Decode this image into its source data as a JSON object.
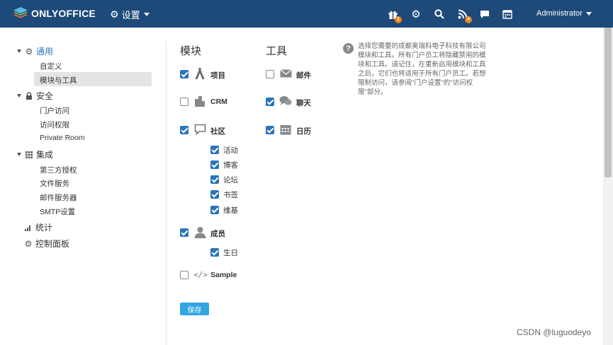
{
  "header": {
    "logo_text": "ONLYOFFICE",
    "settings_label": "设置",
    "badges": {
      "gift": "1",
      "feed": "4"
    },
    "user_name": "Administrator",
    "bg_color": "#1d4a79"
  },
  "sidebar": {
    "general": "通用",
    "general_items": [
      "自定义",
      "模块与工具"
    ],
    "security": "安全",
    "security_items": [
      "门户访问",
      "访问权限",
      "Private Room"
    ],
    "integration": "集成",
    "integration_items": [
      "第三方授权",
      "文件服务",
      "邮件服务器",
      "SMTP设置"
    ],
    "stats": "统计",
    "control_panel": "控制面板"
  },
  "modules": {
    "heading": "模块",
    "items": [
      {
        "label": "项目",
        "checked": true
      },
      {
        "label": "CRM",
        "checked": false
      },
      {
        "label": "社区",
        "checked": true
      },
      {
        "label": "成员",
        "checked": true
      },
      {
        "label": "Sample",
        "checked": false
      }
    ],
    "community_sub": [
      "活动",
      "博客",
      "论坛",
      "书签",
      "维基"
    ],
    "people_sub": [
      "生日"
    ]
  },
  "tools": {
    "heading": "工具",
    "items": [
      {
        "label": "邮件",
        "checked": false
      },
      {
        "label": "聊天",
        "checked": true
      },
      {
        "label": "日历",
        "checked": true
      }
    ]
  },
  "help_text": "选择您需要的成都奥瑞科电子科技有限公司模块和工具。所有门户员工将隐藏禁用的模块和工具。请记住，在重新启用模块和工具之后，它们也将适用于所有门户员工。若想限制访问，请参阅\"门户设置\"的\"访问权限\"部分。",
  "save_label": "保存",
  "watermark": "CSDN @luguodeyo",
  "accent_color": "#2a74b9",
  "button_color": "#32a5e0"
}
